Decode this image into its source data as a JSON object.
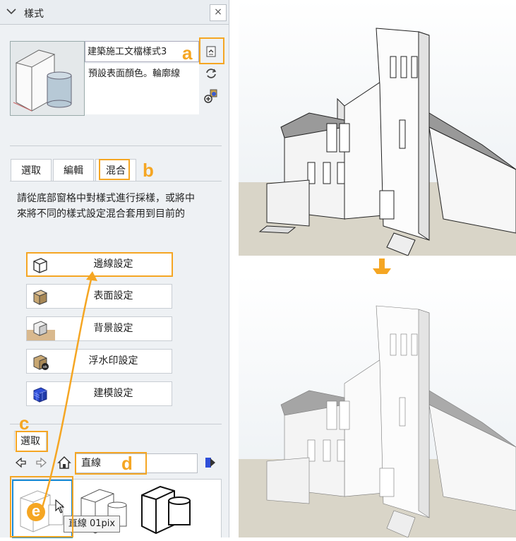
{
  "panel": {
    "title": "樣式",
    "close_glyph": "×",
    "style_name": "建築施工文檔樣式3",
    "style_description": "預設表面顏色。輪廓線",
    "tabs": [
      {
        "label": "選取"
      },
      {
        "label": "編輯"
      },
      {
        "label": "混合"
      }
    ],
    "info_text_line1": "請從底部窗格中對樣式進行採樣，或將中",
    "info_text_line2": "來將不同的樣式設定混合套用到目前的",
    "settings": [
      {
        "label": "邊線設定",
        "icon": "edge-settings-icon"
      },
      {
        "label": "表面設定",
        "icon": "face-settings-icon"
      },
      {
        "label": "背景設定",
        "icon": "background-settings-icon"
      },
      {
        "label": "浮水印設定",
        "icon": "watermark-settings-icon"
      },
      {
        "label": "建模設定",
        "icon": "modeling-settings-icon"
      }
    ],
    "secondary_tab": "選取",
    "collection_value": "直線",
    "tooltip": "直線 01pix"
  },
  "annotations": {
    "a": "a",
    "b": "b",
    "c": "c",
    "d": "d",
    "e": "e",
    "accent_color": "#f5a623"
  }
}
